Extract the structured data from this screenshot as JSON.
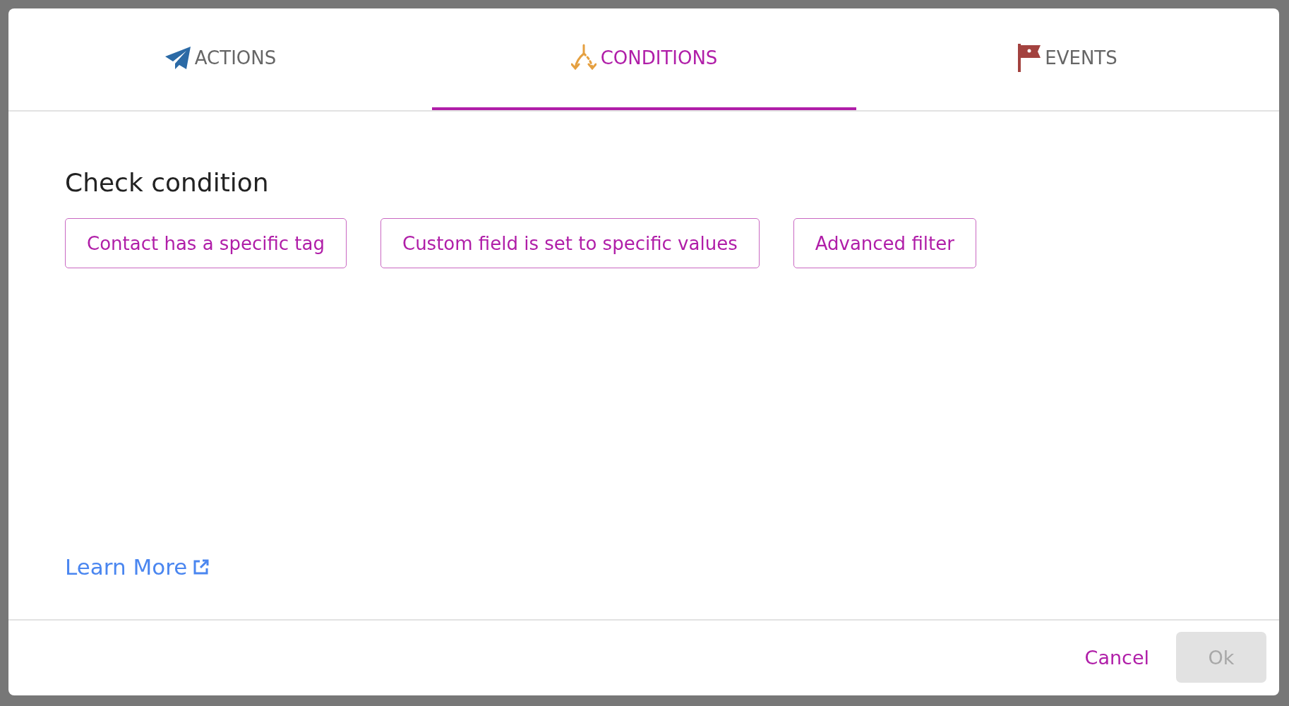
{
  "tabs": [
    {
      "kind": "actions",
      "label": "ACTIONS",
      "selected": false
    },
    {
      "kind": "conditions",
      "label": "CONDITIONS",
      "selected": true
    },
    {
      "kind": "events",
      "label": "EVENTS",
      "selected": false
    }
  ],
  "heading": "Check condition",
  "options": [
    "Contact has a specific tag",
    "Custom field is set to specific values",
    "Advanced filter"
  ],
  "learn_more": "Learn More",
  "footer": {
    "cancel": "Cancel",
    "ok": {
      "label": "Ok",
      "disabled": true
    }
  }
}
